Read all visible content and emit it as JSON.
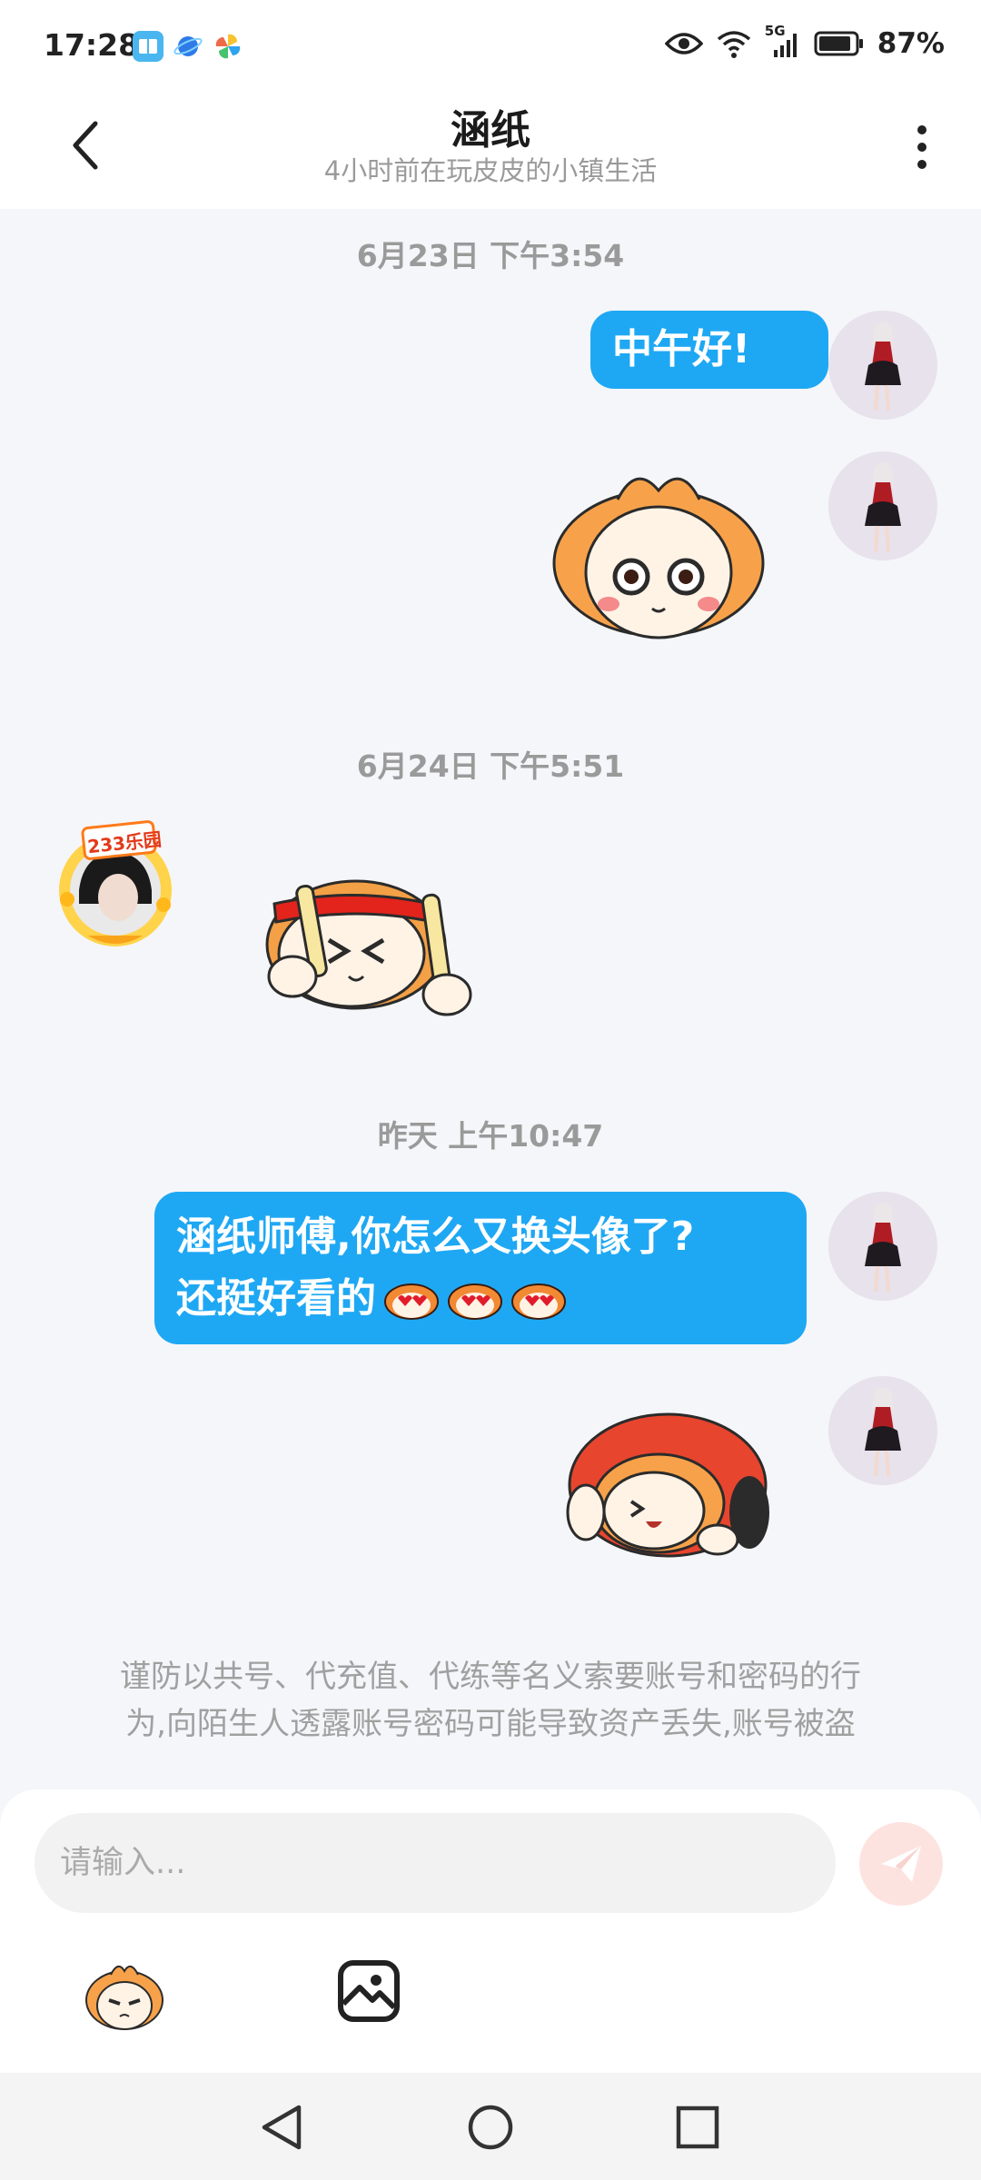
{
  "status_bar": {
    "time": "17:28",
    "network": "5G",
    "battery": "87%",
    "icons": [
      "app-book-icon",
      "app-planet-icon",
      "app-pinwheel-icon",
      "eye-icon",
      "wifi-icon",
      "signal-icon",
      "battery-icon"
    ]
  },
  "header": {
    "title": "涵纸",
    "subtitle": "4小时前在玩皮皮的小镇生活"
  },
  "messages": [
    {
      "type": "timestamp",
      "text": "6月23日 下午3:54"
    },
    {
      "type": "text",
      "side": "right",
      "text": "中午好!"
    },
    {
      "type": "sticker",
      "side": "right",
      "sticker": "orange-face-sticker"
    },
    {
      "type": "timestamp",
      "text": "6月24日 下午5:51"
    },
    {
      "type": "sticker",
      "side": "left",
      "sticker": "cheering-sticks-sticker",
      "avatar_badge": "233乐园"
    },
    {
      "type": "timestamp",
      "text": "昨天 上午10:47"
    },
    {
      "type": "text",
      "side": "right",
      "lines": [
        "涵纸师傅,你怎么又换头像了?",
        "还挺好看的"
      ]
    },
    {
      "type": "sticker",
      "side": "right",
      "sticker": "hug-sticker"
    }
  ],
  "notice": {
    "line1": "谨防以共号、代充值、代练等名义索要账号和密码的行",
    "line2": "为,向陌生人透露账号密码可能导致资产丢失,账号被盗"
  },
  "input": {
    "placeholder": "请输入..."
  },
  "colors": {
    "bubble": "#1ea8f4",
    "send_button_bg": "#fde3e0",
    "send_button_icon": "#f8b4ad"
  }
}
